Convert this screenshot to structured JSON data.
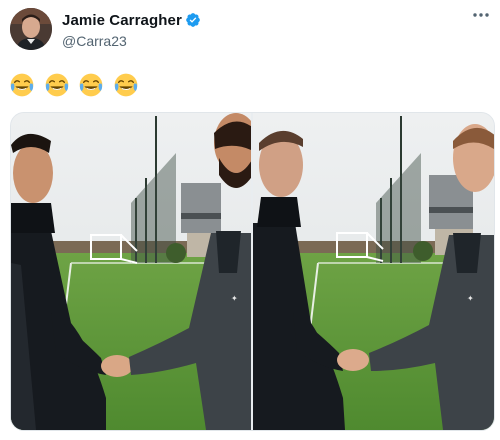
{
  "author": {
    "display_name": "Jamie Carragher",
    "handle": "@Carra23",
    "verified": true,
    "verified_color": "#1d9bf0"
  },
  "tweet": {
    "text": "😂😂😂😂",
    "emoji_icon": "tears-of-joy-icon",
    "emoji_count": 4
  },
  "media": {
    "photos": [
      {
        "name": "photo-ronaldo-handshake"
      },
      {
        "name": "photo-carragher-handshake"
      }
    ]
  },
  "icons": {
    "more": "more-options-icon",
    "verified": "verified-badge-icon"
  },
  "colors": {
    "secondary_text": "#536471",
    "pitch_green": "#5e9a3c",
    "sky": "#e6e9ea"
  }
}
